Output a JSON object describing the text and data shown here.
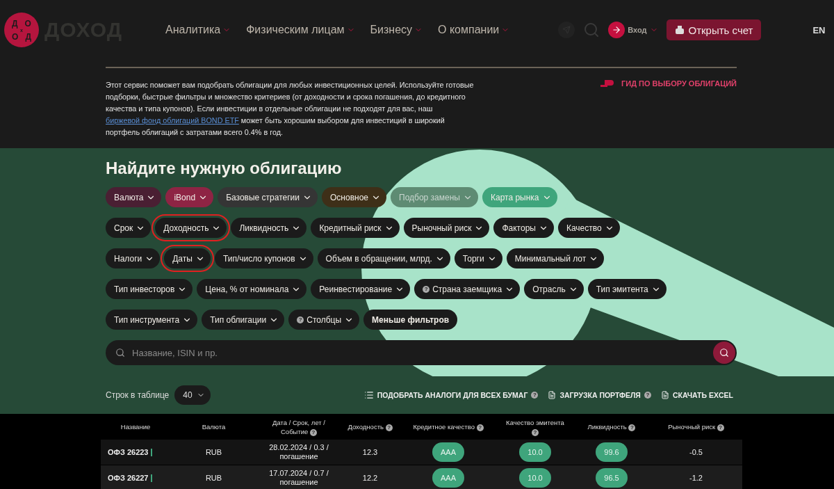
{
  "header": {
    "logo_mark": [
      [
        "Д",
        "О"
      ],
      [
        "x"
      ],
      [
        "О",
        "Д"
      ]
    ],
    "logo_text": "ДОХОД",
    "nav": [
      {
        "label": "Аналитика"
      },
      {
        "label": "Физическим лицам"
      },
      {
        "label": "Бизнесу"
      },
      {
        "label": "О компании"
      }
    ],
    "login": "Вход",
    "open_account": "Открыть счет",
    "language": "EN"
  },
  "intro": {
    "parts": [
      "Этот сервис поможет вам подобрать облигации для любых инвестиционных целей. Используйте готовые подборки, быстрые фильтры и множество критериев (от доходности и срока погашения, до кредитного качества и типа купонов). Если инвестиции в отдельные облигации не подходят для вас, наш ",
      "биржевой фонд облигаций BOND ETF",
      " может быть хорошим выбором для инвестиций в широкий портфель облигаций с затратами всего 0.4% в год."
    ],
    "guide_link": "ГИД ПО ВЫБОРУ ОБЛИГАЦИЙ"
  },
  "finder": {
    "title": "Найдите нужную облигацию",
    "filter_rows": [
      [
        {
          "label": "Валюта",
          "color": "#4a1f33"
        },
        {
          "label": "iBond",
          "color": "#8e2444"
        },
        {
          "label": "Базовые стратегии",
          "color": "#353535"
        },
        {
          "label": "Основное",
          "color": "#3e2f18"
        },
        {
          "label": "Подбор замены",
          "color": "#5e8b73"
        },
        {
          "label": "Карта рынка",
          "color": "#3fa57c"
        }
      ],
      [
        {
          "label": "Срок"
        },
        {
          "label": "Доходность",
          "highlighted": true
        },
        {
          "label": "Ликвидность"
        },
        {
          "label": "Кредитный риск"
        },
        {
          "label": "Рыночный риск"
        },
        {
          "label": "Факторы"
        },
        {
          "label": "Качество"
        }
      ],
      [
        {
          "label": "Налоги"
        },
        {
          "label": "Даты",
          "highlighted": true
        },
        {
          "label": "Тип/число купонов"
        },
        {
          "label": "Объем в обращении, млрд."
        },
        {
          "label": "Торги"
        },
        {
          "label": "Минимальный лот"
        }
      ],
      [
        {
          "label": "Тип инвесторов"
        },
        {
          "label": "Цена, % от номинала"
        },
        {
          "label": "Реинвестирование"
        },
        {
          "label": "Страна заемщика",
          "help": "?"
        },
        {
          "label": "Отрасль"
        },
        {
          "label": "Тип эмитента"
        }
      ],
      [
        {
          "label": "Тип инструмента"
        },
        {
          "label": "Тип облигации"
        },
        {
          "label": "Столбцы",
          "help": "?"
        },
        {
          "label": "Меньше фильтров",
          "kind": "toggle"
        }
      ]
    ],
    "search": {
      "placeholder": "Название, ISIN и пр."
    }
  },
  "toolbar": {
    "rows_label": "Строк в таблице",
    "rows_value": "40",
    "actions": [
      {
        "label": "ПОДОБРАТЬ АНАЛОГИ ДЛЯ ВСЕХ БУМАГ",
        "help": "?"
      },
      {
        "label": "ЗАГРУЗКА ПОРТФЕЛЯ",
        "help": "?"
      },
      {
        "label": "СКАЧАТЬ EXCEL"
      }
    ]
  },
  "table": {
    "columns": [
      {
        "label": "Название"
      },
      {
        "label": "Валюта"
      },
      {
        "label": "Дата / Срок, лет / Событие",
        "help": "?"
      },
      {
        "label": "Доходность",
        "help": "?"
      },
      {
        "label": "Кредитное качество",
        "help": "?"
      },
      {
        "label": "Качество эмитента",
        "help": "?"
      },
      {
        "label": "Ликвидность",
        "help": "?"
      },
      {
        "label": "Рыночный риск",
        "help": "?"
      }
    ],
    "rows": [
      {
        "name": "ОФЗ 26223",
        "currency": "RUB",
        "date": "28.02.2024 / 0.3 / погашение",
        "yield": "12.3",
        "credit": "AAA",
        "issuer": "10.0",
        "liquidity": "99.6",
        "risk": "-0.5"
      },
      {
        "name": "ОФЗ 26227",
        "currency": "RUB",
        "date": "17.07.2024 / 0.7 / погашение",
        "yield": "12.2",
        "credit": "AAA",
        "issuer": "10.0",
        "liquidity": "96.5",
        "risk": "-1.2"
      }
    ]
  }
}
